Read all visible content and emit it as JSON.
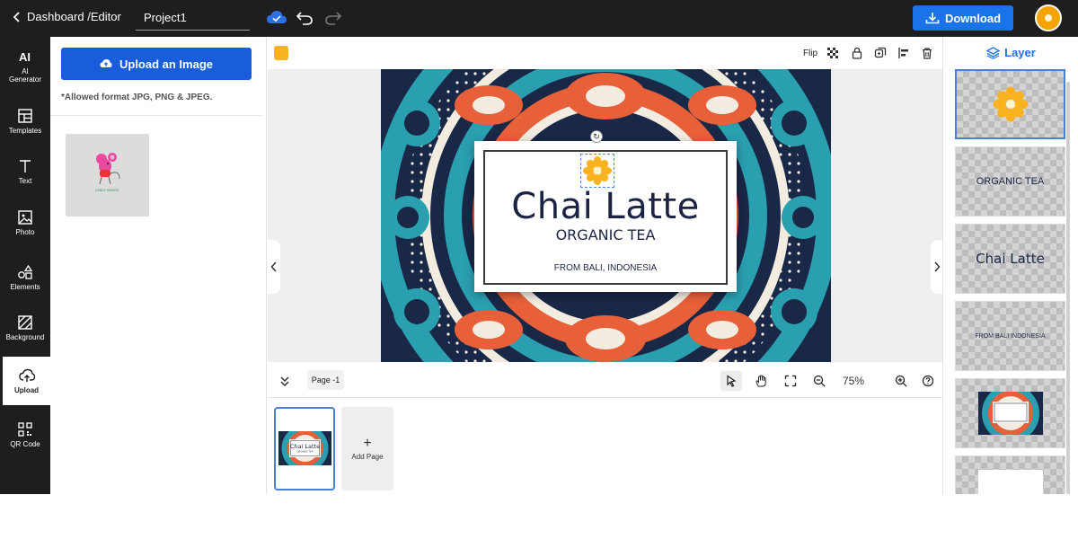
{
  "header": {
    "breadcrumb": "Dashboard /Editor",
    "project_name": "Project1",
    "download_label": "Download"
  },
  "sidebar": {
    "items": [
      {
        "label": "AI Generator",
        "icon": "ai-icon"
      },
      {
        "label": "Templates",
        "icon": "templates-icon"
      },
      {
        "label": "Text",
        "icon": "text-icon"
      },
      {
        "label": "Photo",
        "icon": "photo-icon"
      },
      {
        "label": "Elements",
        "icon": "elements-icon"
      },
      {
        "label": "Background",
        "icon": "background-icon"
      },
      {
        "label": "Upload",
        "icon": "upload-icon"
      },
      {
        "label": "QR Code",
        "icon": "qr-code-icon"
      }
    ],
    "active": "Upload"
  },
  "upload_panel": {
    "button_label": "Upload an Image",
    "allowed_text": "*Allowed format JPG, PNG & JPEG.",
    "uploaded_thumb_caption": "CANDY RIDERS"
  },
  "toolbar": {
    "color": "#fbb21f",
    "flip_label": "Flip"
  },
  "design": {
    "title": "Chai Latte",
    "subtitle": "ORGANIC TEA",
    "origin": "FROM BALI, INDONESIA"
  },
  "bottom_bar": {
    "page_label": "Page -1",
    "zoom": "75%"
  },
  "pages": {
    "add_page_label": "Add Page"
  },
  "layers": {
    "title": "Layer",
    "items": [
      {
        "type": "flower-image"
      },
      {
        "type": "text",
        "text": "ORGANIC TEA"
      },
      {
        "type": "text",
        "text": "Chai Latte"
      },
      {
        "type": "text",
        "text": "FROM BALI INDONESIA"
      },
      {
        "type": "background-image"
      },
      {
        "type": "white-rectangle"
      }
    ]
  }
}
